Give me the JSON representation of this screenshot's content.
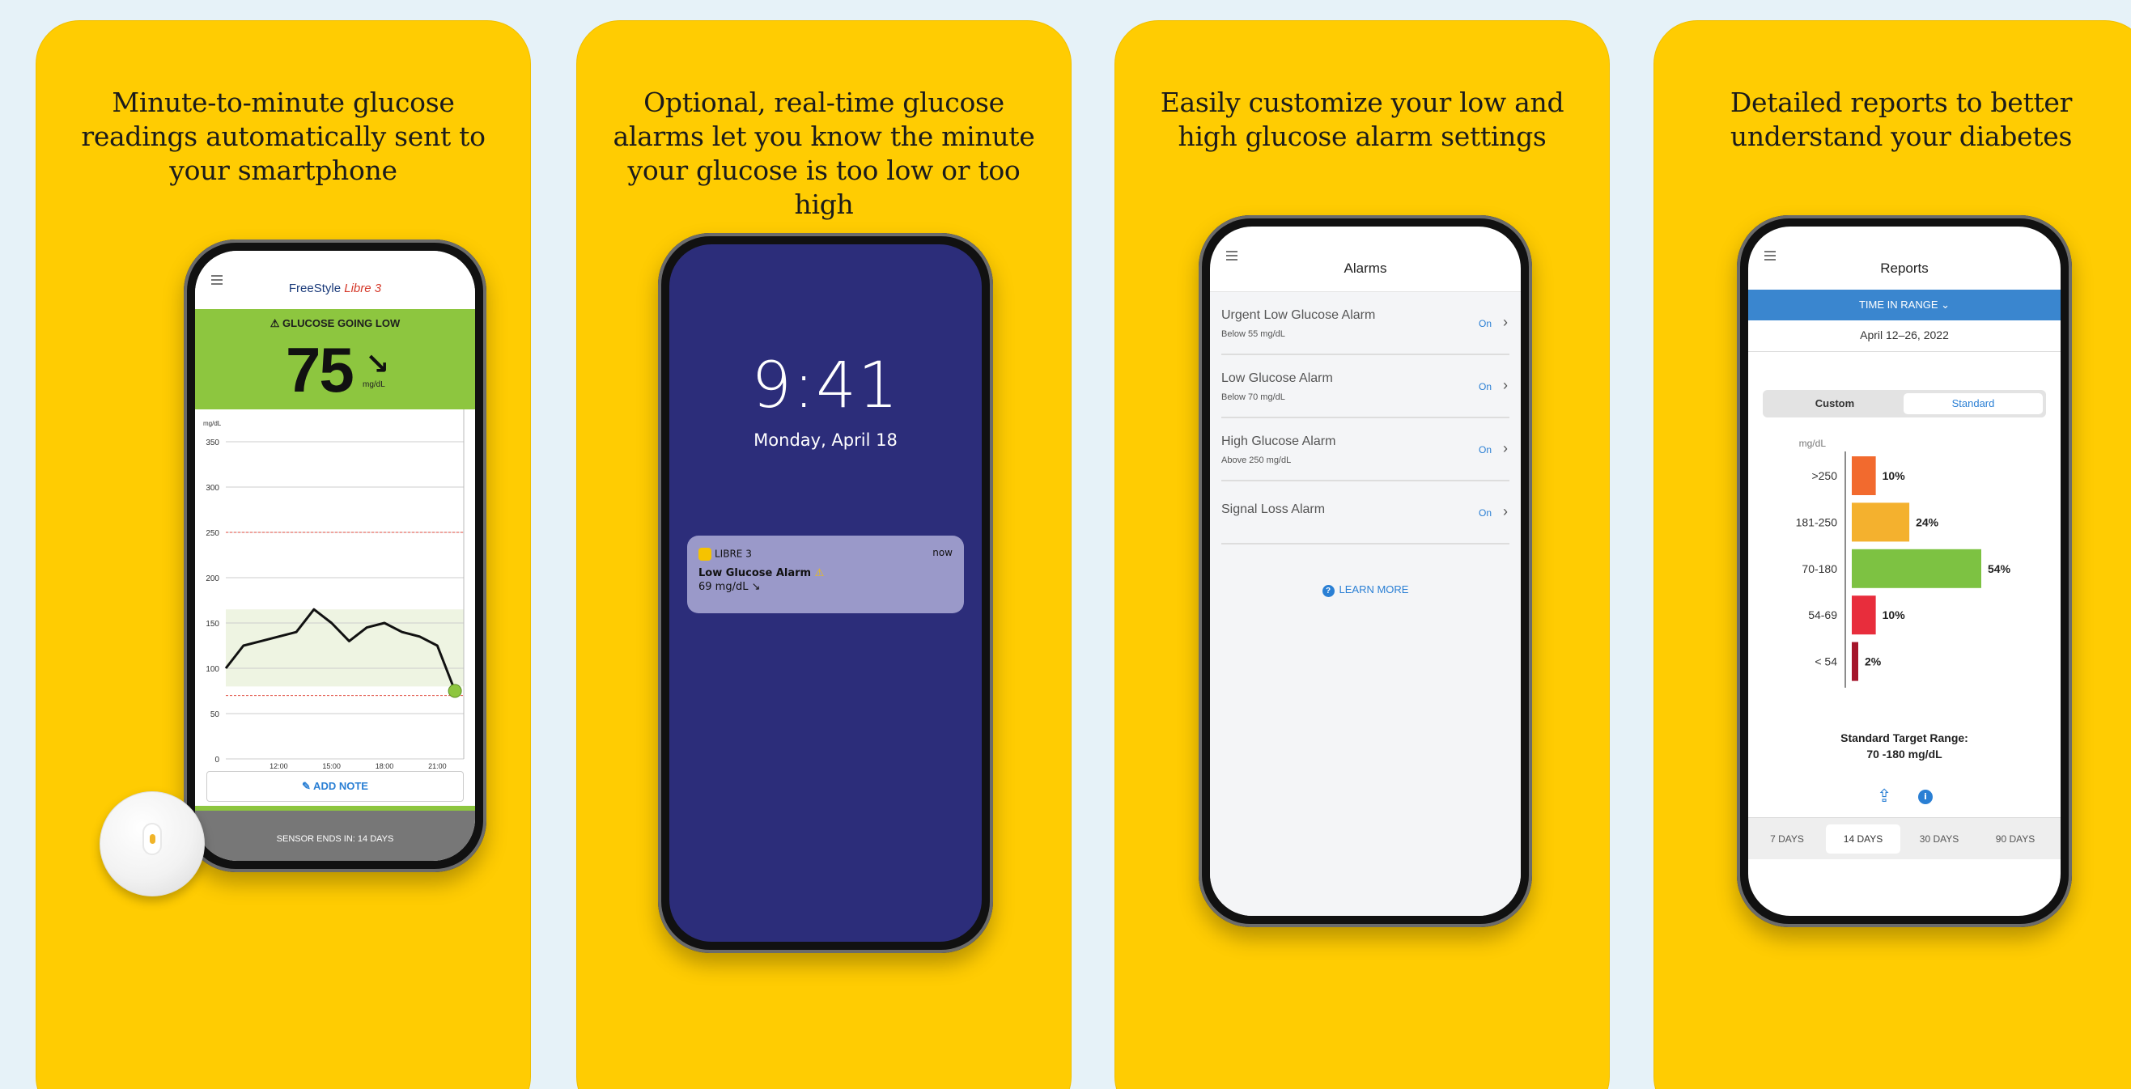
{
  "cards": [
    {
      "caption": "Minute-to-minute glucose readings automatically sent to your smartphone"
    },
    {
      "caption": "Optional, real-time glucose alarms let you know the minute your glucose is too low or too high"
    },
    {
      "caption": "Easily customize your low and high glucose alarm settings"
    },
    {
      "caption": "Detailed reports to better understand your diabetes"
    }
  ],
  "phone1": {
    "brand": "FreeStyle",
    "brand_accent": "Libre 3",
    "alert": "⚠ GLUCOSE GOING LOW",
    "value": "75",
    "arrow": "↘",
    "unit": "mg/dL",
    "add_note": "✎ ADD NOTE",
    "sensor": "SENSOR ENDS IN: 14 DAYS",
    "chart_data": {
      "type": "line",
      "ylabel": "mg/dL",
      "y_ticks": [
        350,
        300,
        250,
        200,
        150,
        100,
        50,
        0
      ],
      "x_ticks": [
        "12:00",
        "15:00",
        "18:00",
        "21:00"
      ],
      "ylim": [
        0,
        350
      ],
      "target_range": [
        80,
        165
      ],
      "alarm_lines": [
        250,
        70
      ],
      "x": [
        9,
        10,
        11,
        12,
        13,
        14,
        15,
        16,
        17,
        18,
        19,
        20,
        21,
        22
      ],
      "y": [
        100,
        125,
        130,
        135,
        140,
        165,
        150,
        130,
        145,
        150,
        140,
        135,
        125,
        75
      ]
    }
  },
  "phone2": {
    "time": "9:41",
    "date": "Monday, April 18",
    "app": "LIBRE 3",
    "when": "now",
    "title": "Low Glucose Alarm",
    "warn": "⚠",
    "value": "69 mg/dL ↘"
  },
  "phone3": {
    "title": "Alarms",
    "alarms": [
      {
        "name": "Urgent Low Glucose Alarm",
        "sub": "Below 55 mg/dL",
        "state": "On"
      },
      {
        "name": "Low Glucose Alarm",
        "sub": "Below 70 mg/dL",
        "state": "On"
      },
      {
        "name": "High Glucose Alarm",
        "sub": "Above 250 mg/dL",
        "state": "On"
      },
      {
        "name": "Signal Loss Alarm",
        "sub": "",
        "state": "On"
      }
    ],
    "learn_more": "LEARN MORE"
  },
  "phone4": {
    "title": "Reports",
    "tab": "TIME IN RANGE ⌄",
    "date": "April 12–26, 2022",
    "seg_custom": "Custom",
    "seg_standard": "Standard",
    "target_line1": "Standard Target Range:",
    "target_line2": "70 -180 mg/dL",
    "days": [
      "7 DAYS",
      "14 DAYS",
      "30 DAYS",
      "90 DAYS"
    ],
    "chart_data": {
      "type": "bar",
      "ylabel": "mg/dL",
      "categories": [
        ">250",
        "181-250",
        "70-180",
        "54-69",
        "< 54"
      ],
      "values": [
        10,
        24,
        54,
        10,
        2
      ],
      "labels": [
        "10%",
        "24%",
        "54%",
        "10%",
        "2%"
      ],
      "colors": [
        "#f26a2e",
        "#f4b12e",
        "#7dc242",
        "#e82d3c",
        "#a5162b"
      ]
    }
  }
}
